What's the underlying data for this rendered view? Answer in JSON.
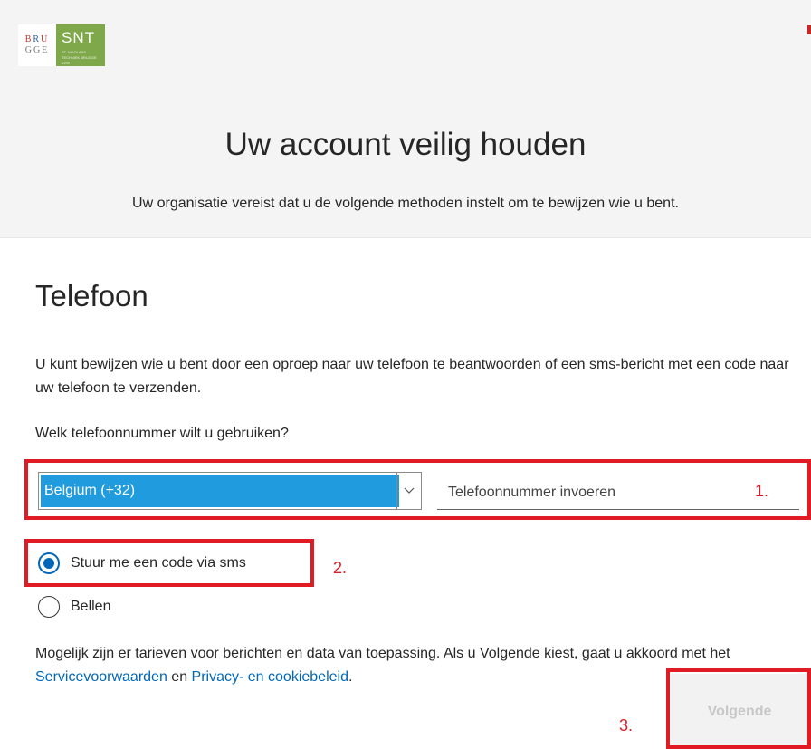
{
  "logo": {
    "brugge_line1": [
      "B",
      "R",
      "U"
    ],
    "brugge_line2": [
      "G",
      "G",
      "E"
    ],
    "snt": "SNT",
    "snt_sub": "ST. NIKOLAAS TECHNIEK BRUGGE VZW"
  },
  "header": {
    "title": "Uw account veilig houden",
    "subtitle": "Uw organisatie vereist dat u de volgende methoden instelt om te bewijzen wie u bent."
  },
  "section": {
    "title": "Telefoon",
    "description": "U kunt bewijzen wie u bent door een oproep naar uw telefoon te beantwoorden of een sms-bericht met een code naar uw telefoon te verzenden.",
    "question": "Welk telefoonnummer wilt u gebruiken?"
  },
  "country_select": {
    "selected": "Belgium (+32)"
  },
  "phone_input": {
    "value": "",
    "placeholder": "Telefoonnummer invoeren"
  },
  "radio_options": [
    {
      "label": "Stuur me een code via sms",
      "checked": true
    },
    {
      "label": "Bellen",
      "checked": false
    }
  ],
  "terms": {
    "prefix": "Mogelijk zijn er tarieven voor berichten en data van toepassing. Als u Volgende kiest, gaat u akkoord met het ",
    "link1": "Servicevoorwaarden",
    "middle": " en ",
    "link2": "Privacy- en cookiebeleid",
    "suffix": "."
  },
  "next_button": {
    "label": "Volgende"
  },
  "annotations": [
    "1.",
    "2.",
    "3."
  ],
  "colors": {
    "annotation": "#e01b24",
    "accent": "#0067b8",
    "select_highlight": "#1f9bde",
    "logo_green": "#7fa84b"
  }
}
